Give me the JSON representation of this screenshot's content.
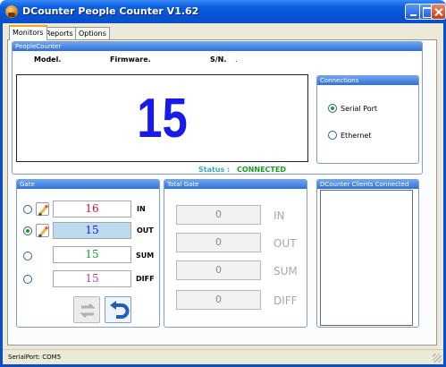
{
  "window": {
    "title": "DCounter People Counter V1.62"
  },
  "tabs": [
    {
      "label": "Monitors",
      "active": true
    },
    {
      "label": "Reports",
      "active": false
    },
    {
      "label": "Options",
      "active": false
    }
  ],
  "people_counter": {
    "group_title": "PeopleCounter",
    "model_label": "Model.",
    "firmware_label": "Firmware.",
    "sn_label": "S/N.",
    "sn_value": ".",
    "big_count": "15",
    "status_label": "Status :",
    "status_value": "CONNECTED"
  },
  "connections": {
    "group_title": "Connections",
    "options": [
      {
        "label": "Serial Port",
        "selected": true
      },
      {
        "label": "Ethernet",
        "selected": false
      }
    ]
  },
  "gate": {
    "group_title": "Gate",
    "rows": [
      {
        "value": "16",
        "label": "IN",
        "color": "#c8102e",
        "selected": false
      },
      {
        "value": "15",
        "label": "OUT",
        "color": "#1a1ae8",
        "selected": true
      },
      {
        "value": "15",
        "label": "SUM",
        "color": "#1d9a2a",
        "selected": false
      },
      {
        "value": "15",
        "label": "DIFF",
        "color": "#b040b0",
        "selected": false
      }
    ]
  },
  "total_gate": {
    "group_title": "Total Gate",
    "rows": [
      {
        "value": "0",
        "label": "IN"
      },
      {
        "value": "0",
        "label": "OUT"
      },
      {
        "value": "0",
        "label": "SUM"
      },
      {
        "value": "0",
        "label": "DIFF"
      }
    ]
  },
  "clients": {
    "group_title": "DCounter Clients Connected"
  },
  "statusbar": {
    "text": "SerialPort:  COM5"
  },
  "colors": {
    "titlebar": "#0852d4",
    "frame": "#ece9d8",
    "selected_field": "#bcdaf0",
    "accent_blue": "#1a1ae8"
  }
}
